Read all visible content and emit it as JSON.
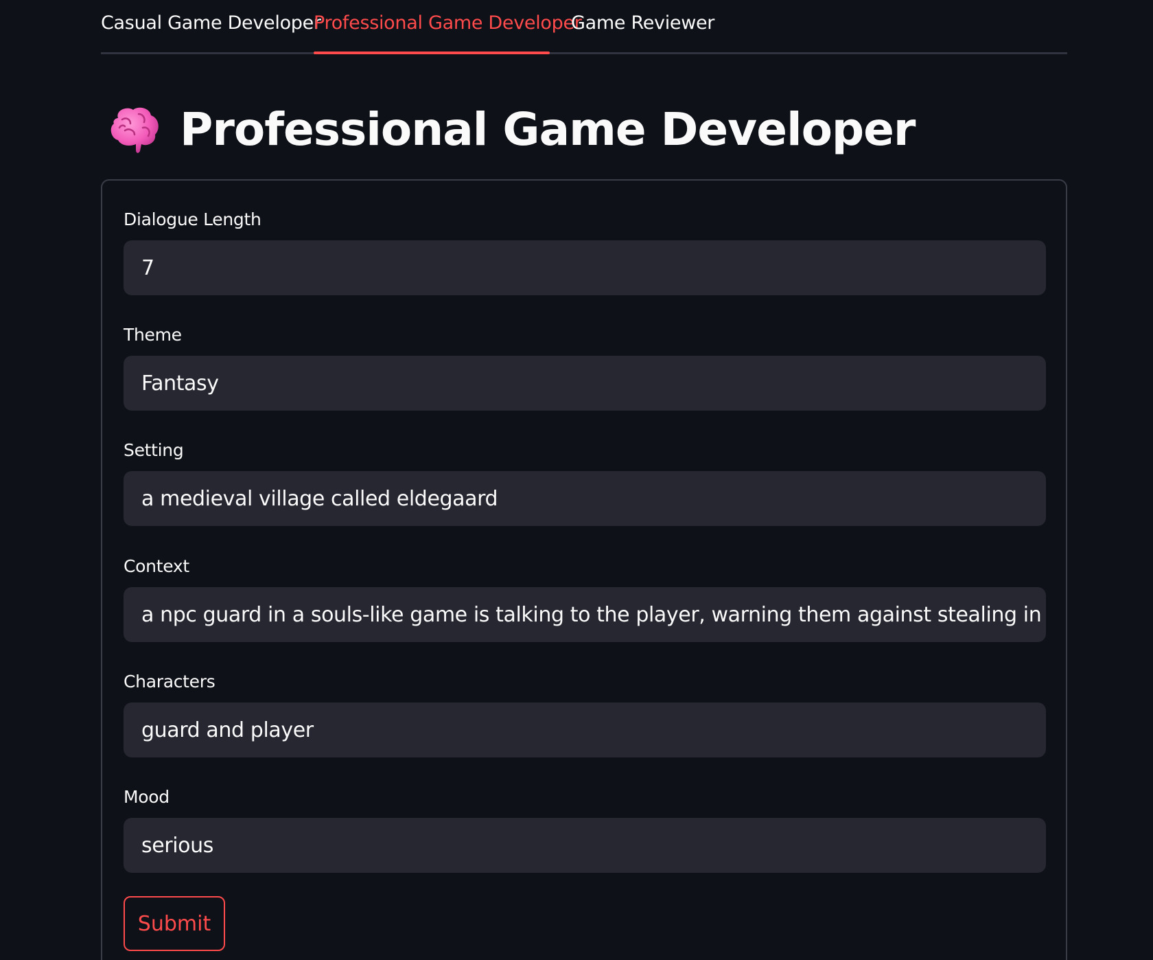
{
  "tabs": [
    {
      "label": "Casual Game Developer",
      "active": false
    },
    {
      "label": "Professional Game Developer",
      "active": true
    },
    {
      "label": "Game Reviewer",
      "active": false
    }
  ],
  "header": {
    "icon": "brain-icon",
    "title": "Professional Game Developer"
  },
  "form": {
    "fields": [
      {
        "label": "Dialogue Length",
        "value": "7"
      },
      {
        "label": "Theme",
        "value": "Fantasy"
      },
      {
        "label": "Setting",
        "value": "a medieval village called eldegaard"
      },
      {
        "label": "Context",
        "value": "a npc guard in a souls-like game is talking to the player, warning them against stealing in the village"
      },
      {
        "label": "Characters",
        "value": "guard and player"
      },
      {
        "label": "Mood",
        "value": "serious"
      }
    ],
    "submit_label": "Submit"
  },
  "colors": {
    "background": "#0e1117",
    "accent": "#ff4b4b",
    "input_background": "#262730",
    "text": "#fafafa"
  }
}
